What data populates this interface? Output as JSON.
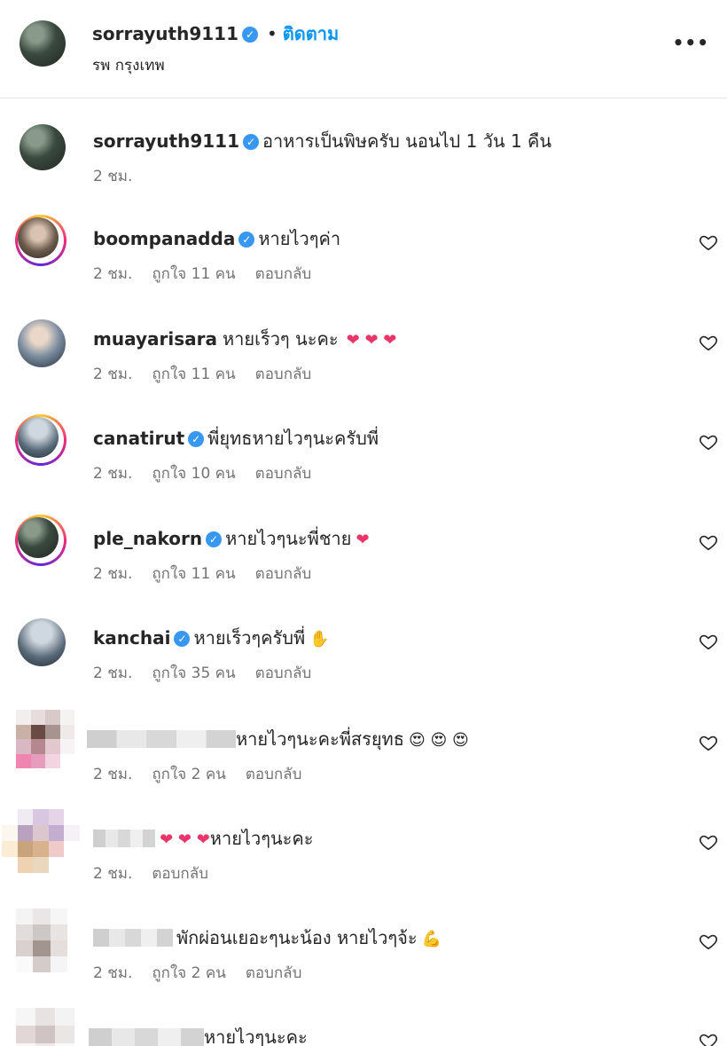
{
  "post": {
    "username": "sorrayuth9111",
    "follow_label": "ติดตาม",
    "location": "รพ กรุงเทพ",
    "more_label": "•••"
  },
  "caption": {
    "username": "sorrayuth9111",
    "text": "อาหารเป็นพิษครับ นอนไป 1 วัน 1 คืน",
    "time": "2 ชม."
  },
  "comments": [
    {
      "username": "boompanadda",
      "verified": true,
      "text": "หายไวๆค่า",
      "time": "2 ชม.",
      "likes": "ถูกใจ 11 คน",
      "reply": "ตอบกลับ"
    },
    {
      "username": "muayarisara",
      "verified": false,
      "text": "หายเร็วๆ นะคะ",
      "time": "2 ชม.",
      "likes": "ถูกใจ 11 คน",
      "reply": "ตอบกลับ"
    },
    {
      "username": "canatirut",
      "verified": true,
      "text": "พี่ยุทธหายไวๆนะครับพี่",
      "time": "2 ชม.",
      "likes": "ถูกใจ 10 คน",
      "reply": "ตอบกลับ"
    },
    {
      "username": "ple_nakorn",
      "verified": true,
      "text": "หายไวๆนะพี่ชาย",
      "time": "2 ชม.",
      "likes": "ถูกใจ 11 คน",
      "reply": "ตอบกลับ"
    },
    {
      "username": "kanchai",
      "verified": true,
      "text": "หายเร็วๆครับพี่",
      "time": "2 ชม.",
      "likes": "ถูกใจ 35 คน",
      "reply": "ตอบกลับ"
    },
    {
      "username": "",
      "verified": false,
      "text": "หายไวๆนะคะพี่สรยุทธ",
      "time": "2 ชม.",
      "likes": "ถูกใจ 2 คน",
      "reply": "ตอบกลับ"
    },
    {
      "username": "",
      "verified": false,
      "text": "หายไวๆนะคะ",
      "time": "2 ชม.",
      "likes": "",
      "reply": "ตอบกลับ"
    },
    {
      "username": "",
      "verified": false,
      "text": "พักผ่อนเยอะๆนะน้อง หายไวๆจ้ะ",
      "time": "2 ชม.",
      "likes": "ถูกใจ 2 คน",
      "reply": "ตอบกลับ"
    },
    {
      "username": "",
      "verified": false,
      "text": "หายไวๆนะคะ",
      "time": "",
      "likes": "",
      "reply": ""
    }
  ],
  "icons": {
    "verified": "verified-check-icon",
    "heart": "heart-outline-icon",
    "more": "more-options-icon"
  },
  "colors": {
    "verified": "#3897f0",
    "follow": "#0095f6",
    "meta": "#737373",
    "heart_emoji": "#e8366a"
  }
}
